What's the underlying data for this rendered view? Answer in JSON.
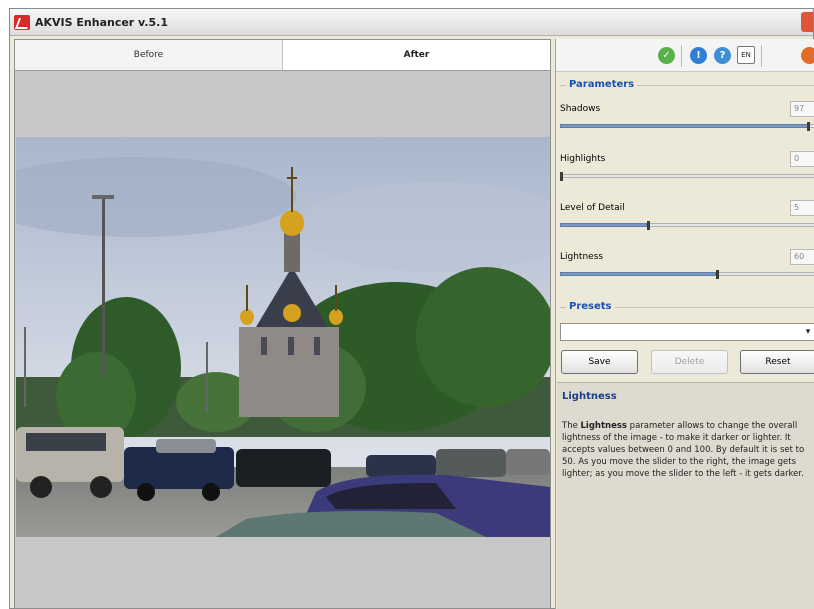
{
  "window": {
    "title": "AKVIS Enhancer v.5.1"
  },
  "tabs": [
    {
      "label": "Before"
    },
    {
      "label": "After"
    }
  ],
  "toolbar": {
    "icons": [
      "apply-icon",
      "info-icon",
      "help-icon",
      "language-icon",
      "akvis-icon"
    ],
    "language_label": "EN"
  },
  "parameters": {
    "title": "Parameters",
    "items": [
      {
        "label": "Shadows",
        "value": "97",
        "level": 97
      },
      {
        "label": "Highlights",
        "value": "0",
        "level": 0
      },
      {
        "label": "Level of Detail",
        "value": "5",
        "level": 5
      },
      {
        "label": "Lightness",
        "value": "60",
        "level": 60
      }
    ]
  },
  "presets": {
    "title": "Presets",
    "selected": "",
    "save_label": "Save",
    "delete_label": "Delete",
    "reset_label": "Reset"
  },
  "help": {
    "title": "Lightness",
    "text_bold": "Lightness",
    "text_prefix": "The ",
    "text_rest": " parameter allows to change the overall lightness of the image - to make it darker or lighter. It accepts values between 0 and 100. By default it is set to 50. As you move the slider to the right, the image gets lighter; as you move the slider to the left - it gets darker."
  },
  "colors": {
    "accent": "#1650b4",
    "slider_fill": "#7a96c4"
  }
}
